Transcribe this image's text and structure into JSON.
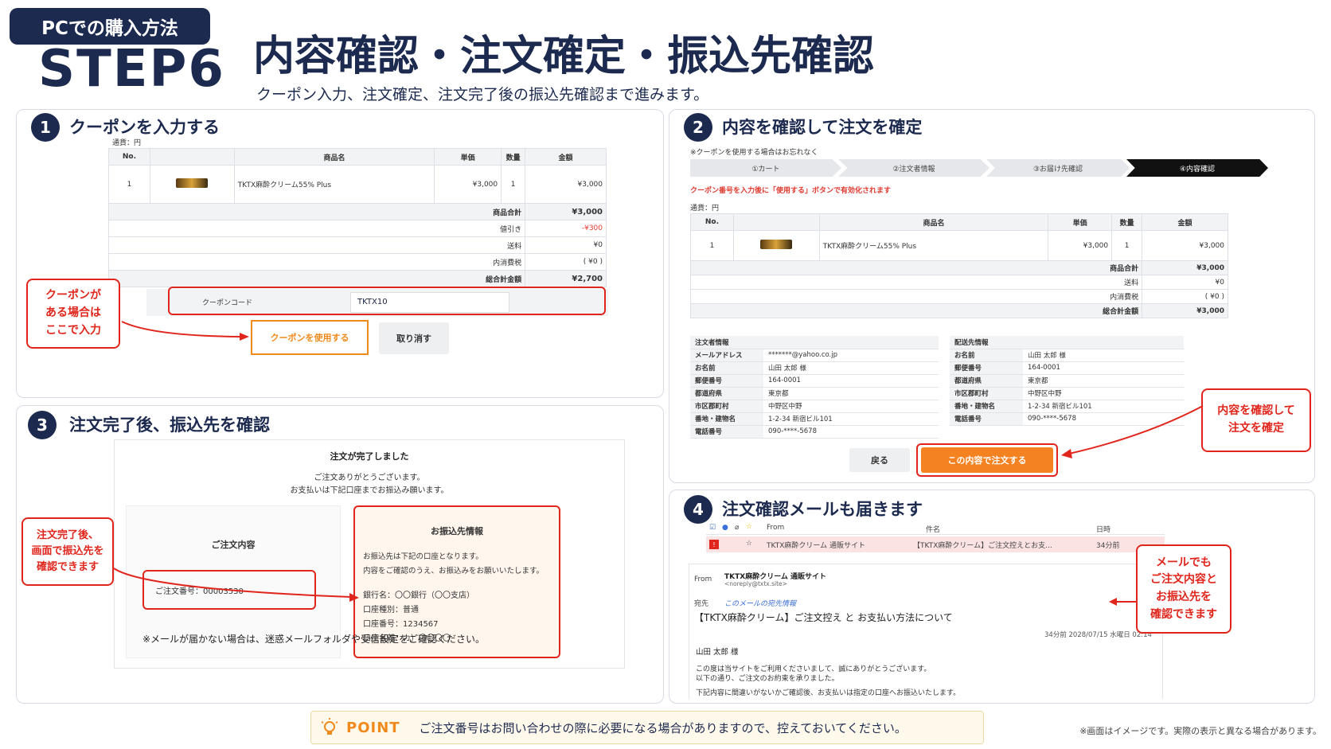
{
  "header": {
    "tag": "PCでの購入方法",
    "step": "STEP6",
    "title": "内容確認・注文確定・振込先確認",
    "subtitle": "クーポン入力、注文確定、注文完了後の振込先確認まで進みます。"
  },
  "panel1": {
    "num": "1",
    "title": "クーポンを入力する",
    "currency": "通貨：円",
    "columns": [
      "No.",
      "商品名",
      "単価",
      "数量",
      "金額"
    ],
    "item": {
      "no": "1",
      "name": "TKTX麻酔クリーム55% Plus",
      "price": "¥3,000",
      "qty": "1",
      "amount": "¥3,000"
    },
    "summary": [
      {
        "label": "商品合計",
        "value": "¥3,000"
      },
      {
        "label": "値引き",
        "value": "-¥300"
      },
      {
        "label": "送料",
        "value": "¥0"
      },
      {
        "label": "内消費税",
        "value": "( ¥0 )"
      },
      {
        "label": "総合計金額",
        "value": "¥2,700"
      }
    ],
    "coupon_label": "クーポンコード",
    "coupon_value": "TKTX10",
    "use_button": "クーポンを使用する",
    "cancel_button": "取り消す",
    "callout": "クーポンが ある場合は ここで入力"
  },
  "panel2": {
    "num": "2",
    "title": "内容を確認して注文を確定",
    "note": "※クーポンを使用する場合はお忘れなく",
    "steps": [
      "①カート",
      "②注文者情報",
      "③お届け先確認",
      "④内容確認"
    ],
    "coupon_warning": "クーポン番号を入力後に「使用する」ボタンで有効化されます",
    "currency": "通貨：円",
    "columns": [
      "No.",
      "商品名",
      "単価",
      "数量",
      "金額"
    ],
    "item": {
      "no": "1",
      "name": "TKTX麻酔クリーム55% Plus",
      "price": "¥3,000",
      "qty": "1",
      "amount": "¥3,000"
    },
    "summary": [
      {
        "label": "商品合計",
        "value": "¥3,000"
      },
      {
        "label": "送料",
        "value": "¥0"
      },
      {
        "label": "内消費税",
        "value": "( ¥0 )"
      },
      {
        "label": "総合計金額",
        "value": "¥3,000"
      }
    ],
    "orderer_title": "注文者情報",
    "orderer": [
      {
        "k": "メールアドレス",
        "v": "*******@yahoo.co.jp"
      },
      {
        "k": "お名前",
        "v": "山田 太郎 様"
      },
      {
        "k": "郵便番号",
        "v": "164-0001"
      },
      {
        "k": "都道府県",
        "v": "東京都"
      },
      {
        "k": "市区郡町村",
        "v": "中野区中野"
      },
      {
        "k": "番地・建物名",
        "v": "1-2-34 新宿ビル101"
      },
      {
        "k": "電話番号",
        "v": "090-****-5678"
      }
    ],
    "shipping_title": "配送先情報",
    "shipping": [
      {
        "k": "お名前",
        "v": "山田 太郎 様"
      },
      {
        "k": "郵便番号",
        "v": "164-0001"
      },
      {
        "k": "都道府県",
        "v": "東京都"
      },
      {
        "k": "市区郡町村",
        "v": "中野区中野"
      },
      {
        "k": "番地・建物名",
        "v": "1-2-34 新宿ビル101"
      },
      {
        "k": "電話番号",
        "v": "090-****-5678"
      }
    ],
    "back_button": "戻る",
    "order_button": "この内容で注文する",
    "callout": "内容を確認して 注文を確定"
  },
  "panel3": {
    "num": "3",
    "title": "注文完了後、振込先を確認",
    "complete": "注文が完了しました",
    "thanks1": "ご注文ありがとうございます。",
    "thanks2": "お支払いは下記口座までお振込み願います。",
    "order_title": "ご注文内容",
    "order_no": "ご注文番号：00003530",
    "bank_title": "お振込先情報",
    "bank_line1": "お振込先は下記の口座となります。",
    "bank_line2": "内容をご確認のうえ、お振込みをお願いいたします。",
    "bank_name": "銀行名：〇〇銀行（〇〇支店）",
    "bank_type": "口座種別：普通",
    "bank_number": "口座番号：1234567",
    "bank_holder": "口座名義：カ）〇〇〇〇",
    "footnote": "※メールが届かない場合は、迷惑メールフォルダや受信設定をご確認ください。",
    "callout": "注文完了後、 画面で振込先を 確認できます"
  },
  "panel4": {
    "num": "4",
    "title": "注文確認メールも届きます",
    "list_from_header": "From",
    "list_subject_header": "件名",
    "list_date_header": "日時",
    "list_sender": "TKTX麻酔クリーム 通販サイト",
    "list_subject": "【TKTX麻酔クリーム】ご注文控えとお支...",
    "list_time": "34分前",
    "from_label": "From",
    "from_name": "TKTX麻酔クリーム 通販サイト",
    "from_addr": "<noreply@txtx.site>",
    "to_label": "宛先",
    "to_value": "このメールの宛先情報",
    "subject": "【TKTX麻酔クリーム】ご注文控え と お支払い方法について",
    "date": "34分前  2028/07/15 水曜日 02:14",
    "greeting": "山田 太郎 様",
    "body1": "この度は当サイトをご利用くださいまして、誠にありがとうございます。",
    "body2": "以下の通り、ご注文のお約束を承りました。",
    "body3": "下記内容に間違いがないかご確認後、お支払いは指定の口座へお振込いたします。",
    "callout": "メールでも ご注文内容と お振込先を 確認できます"
  },
  "point": {
    "label": "POINT",
    "text": "ご注文番号はお問い合わせの際に必要になる場合がありますので、控えておいてください。"
  },
  "disclaimer": "※画面はイメージです。実際の表示と異なる場合があります。"
}
